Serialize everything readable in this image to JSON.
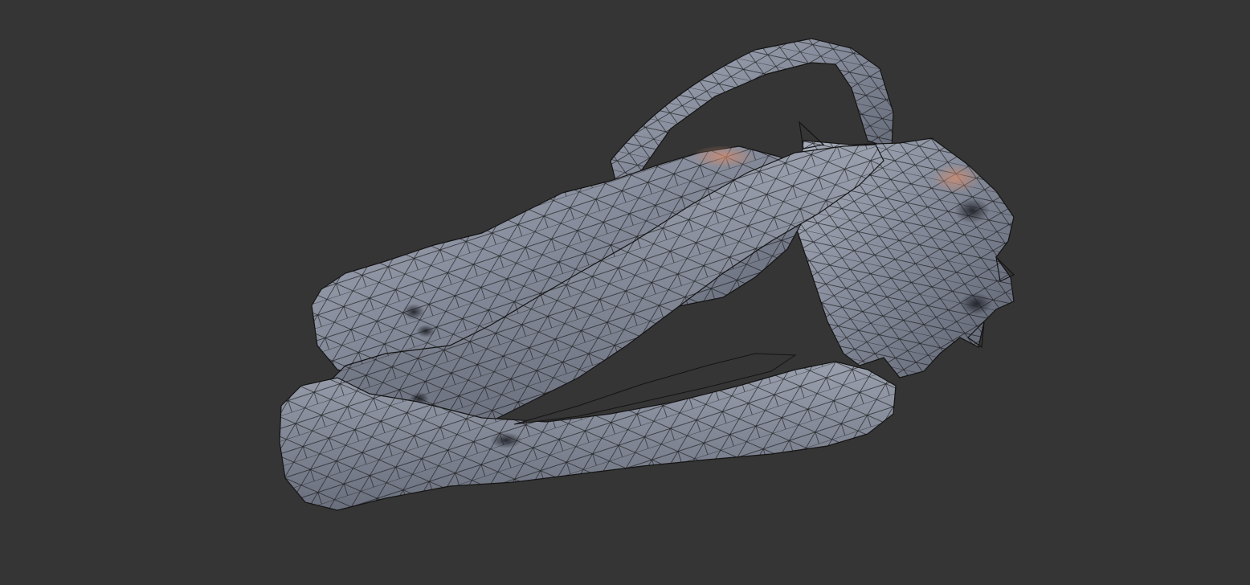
{
  "viewport": {
    "background_color": "#353535",
    "model": {
      "subject": "skull-mesh",
      "render_mode": "shaded-wireframe",
      "surface_color": "#8a90a0",
      "highlight_color": "#c98a6e",
      "wire_color": "#151515"
    }
  }
}
